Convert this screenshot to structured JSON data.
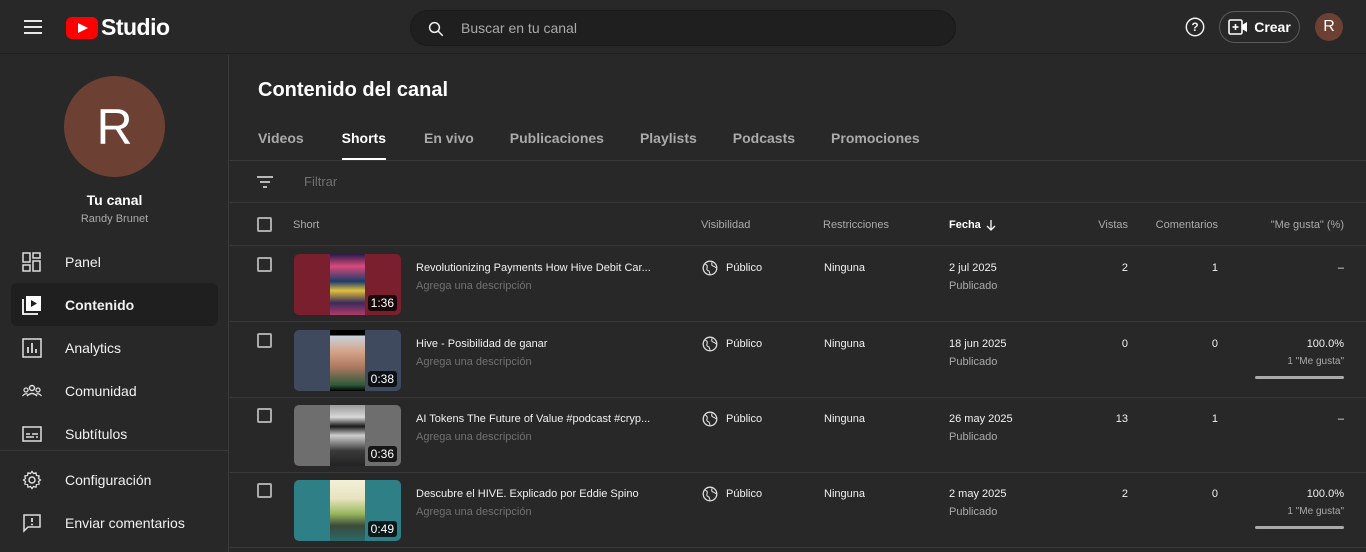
{
  "header": {
    "logo_text": "Studio",
    "search_placeholder": "Buscar en tu canal",
    "create_label": "Crear",
    "avatar_initial": "R"
  },
  "sidebar": {
    "avatar_initial": "R",
    "channel_label": "Tu canal",
    "channel_name": "Randy Brunet",
    "items": [
      {
        "label": "Panel",
        "icon": "dashboard-icon"
      },
      {
        "label": "Contenido",
        "icon": "content-icon",
        "active": true
      },
      {
        "label": "Analytics",
        "icon": "analytics-icon"
      },
      {
        "label": "Comunidad",
        "icon": "community-icon"
      },
      {
        "label": "Subtítulos",
        "icon": "subtitles-icon"
      },
      {
        "label": "Configuración",
        "icon": "gear-icon"
      },
      {
        "label": "Enviar comentarios",
        "icon": "feedback-icon"
      }
    ]
  },
  "main": {
    "title": "Contenido del canal",
    "tabs": [
      "Videos",
      "Shorts",
      "En vivo",
      "Publicaciones",
      "Playlists",
      "Podcasts",
      "Promociones"
    ],
    "active_tab": "Shorts",
    "filter_placeholder": "Filtrar",
    "columns": {
      "short": "Short",
      "visibility": "Visibilidad",
      "restrictions": "Restricciones",
      "date": "Fecha",
      "views": "Vistas",
      "comments": "Comentarios",
      "likes": "\"Me gusta\" (%)"
    },
    "rows": [
      {
        "title": "Revolutionizing Payments How Hive Debit Car...",
        "description": "Agrega una descripción",
        "duration": "1:36",
        "visibility": "Público",
        "restrictions": "Ninguna",
        "date": "2 jul 2025",
        "date_status": "Publicado",
        "views": "2",
        "comments": "1",
        "likes": "–",
        "likes_sub": ""
      },
      {
        "title": "Hive - Posibilidad de ganar",
        "description": "Agrega una descripción",
        "duration": "0:38",
        "visibility": "Público",
        "restrictions": "Ninguna",
        "date": "18 jun 2025",
        "date_status": "Publicado",
        "views": "0",
        "comments": "0",
        "likes": "100.0%",
        "likes_sub": "1 \"Me gusta\""
      },
      {
        "title": "AI Tokens The Future of Value #podcast #cryp...",
        "description": "Agrega una descripción",
        "duration": "0:36",
        "visibility": "Público",
        "restrictions": "Ninguna",
        "date": "26 may 2025",
        "date_status": "Publicado",
        "views": "13",
        "comments": "1",
        "likes": "–",
        "likes_sub": ""
      },
      {
        "title": "Descubre el HIVE. Explicado por Eddie Spino",
        "description": "Agrega una descripción",
        "duration": "0:49",
        "visibility": "Público",
        "restrictions": "Ninguna",
        "date": "2 may 2025",
        "date_status": "Publicado",
        "views": "2",
        "comments": "0",
        "likes": "100.0%",
        "likes_sub": "1 \"Me gusta\""
      }
    ]
  },
  "colors": {
    "brand_red": "#ff0000",
    "avatar": "#6d4034",
    "background": "#282828"
  }
}
